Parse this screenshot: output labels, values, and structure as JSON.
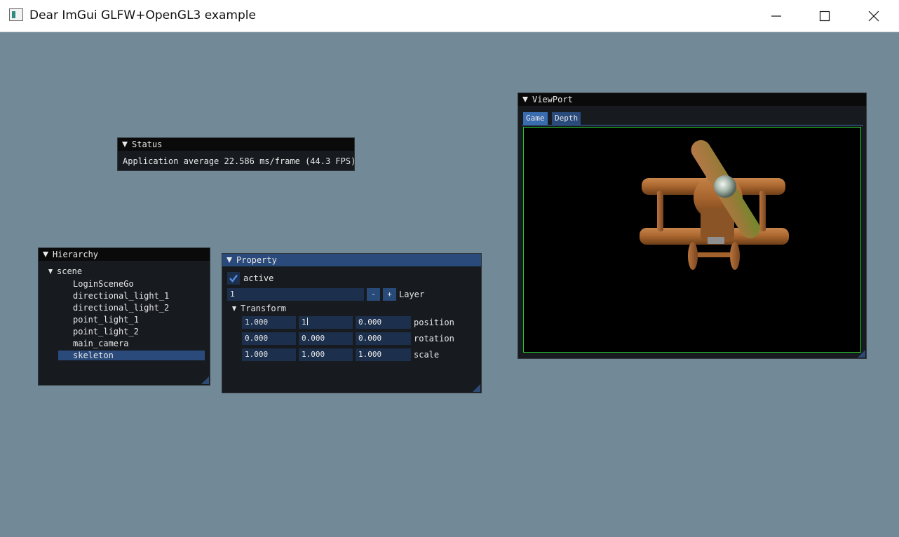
{
  "window": {
    "title": "Dear ImGui GLFW+OpenGL3 example",
    "controls": [
      "minimize-icon",
      "maximize-icon",
      "close-icon"
    ]
  },
  "colors": {
    "background": "#728a98",
    "panel_bg": "#111317",
    "title_active": "#294a7a",
    "frame_bg": "#1c2f4c",
    "accent": "#3a6cb0",
    "viewport_border": "#27c42c"
  },
  "status": {
    "title": "Status",
    "text": "Application average 22.586 ms/frame (44.3 FPS)"
  },
  "hierarchy": {
    "title": "Hierarchy",
    "root": "scene",
    "items": [
      {
        "label": "LoginSceneGo",
        "selected": false
      },
      {
        "label": "directional_light_1",
        "selected": false
      },
      {
        "label": "directional_light_2",
        "selected": false
      },
      {
        "label": "point_light_1",
        "selected": false
      },
      {
        "label": "point_light_2",
        "selected": false
      },
      {
        "label": "main_camera",
        "selected": false
      },
      {
        "label": "skeleton",
        "selected": true
      }
    ]
  },
  "property": {
    "title": "Property",
    "active_label": "active",
    "active_checked": true,
    "layer_value": "1",
    "layer_minus": "-",
    "layer_plus": "+",
    "layer_label": "Layer",
    "transform_label": "Transform",
    "rows": [
      {
        "label": "position",
        "values": [
          "1.000",
          "1",
          "0.000"
        ]
      },
      {
        "label": "rotation",
        "values": [
          "0.000",
          "0.000",
          "0.000"
        ]
      },
      {
        "label": "scale",
        "values": [
          "1.000",
          "1.000",
          "1.000"
        ]
      }
    ]
  },
  "viewport": {
    "title": "ViewPort",
    "tabs": [
      {
        "label": "Game",
        "active": true
      },
      {
        "label": "Depth",
        "active": false
      }
    ],
    "scene_object": "wooden toy biplane"
  }
}
